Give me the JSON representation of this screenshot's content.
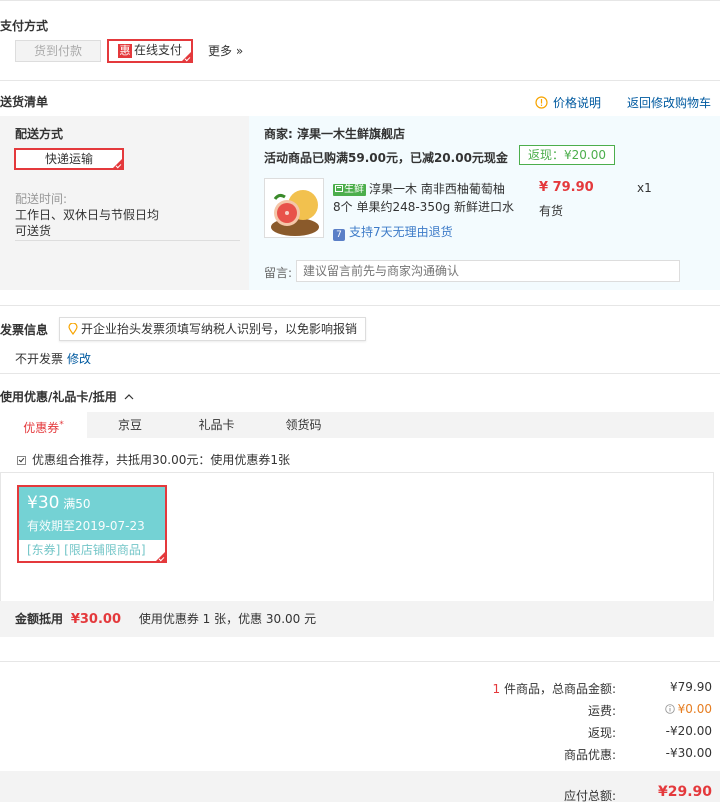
{
  "payment": {
    "title": "支付方式",
    "cod_label": "货到付款",
    "hui_badge": "惠",
    "online_label": "在线支付",
    "more_label": "更多 »"
  },
  "delivery": {
    "title": "送货清单",
    "price_info_link": "价格说明",
    "back_to_cart_link": "返回修改购物车",
    "method_title": "配送方式",
    "method_value": "快递运输",
    "time_label": "配送时间:",
    "time_value_line1": "工作日、双休日与节假日均",
    "time_value_line2": "可送货"
  },
  "shop": {
    "merchant_label": "商家:",
    "merchant_name": "淳果一木生鲜旗舰店",
    "promo_text": "活动商品已购满59.00元，已减20.00元现金",
    "fanxian_label": "返现：¥20.00"
  },
  "product": {
    "tag": "生鲜",
    "name_line1": "淳果一木 南非西柚葡萄柚",
    "name_line2": "8个 单果约248-350g 新鲜进口水",
    "price": "¥ 79.90",
    "quantity": "x1",
    "stock": "有货",
    "return_policy": "支持7天无理由退货"
  },
  "message": {
    "label": "留言:",
    "placeholder": "建议留言前先与商家沟通确认"
  },
  "invoice": {
    "title": "发票信息",
    "tip": "开企业抬头发票须填写纳税人识别号，以免影响报销",
    "value": "不开发票",
    "edit_link": "修改"
  },
  "coupons": {
    "title": "使用优惠/礼品卡/抵用",
    "tabs": [
      "优惠券",
      "京豆",
      "礼品卡",
      "领货码"
    ],
    "tab_mark": "*",
    "recommend_text": "优惠组合推荐，共抵用30.00元：使用优惠券1张",
    "coupon_amount": "¥30",
    "coupon_condition": "满50",
    "coupon_expiry": "有效期至2019-07-23",
    "coupon_scope": "[东券]  [限店铺限商品]",
    "summary_label": "金额抵用",
    "summary_amount": "¥30.00",
    "summary_detail": "使用优惠券 1 张，优惠 30.00 元"
  },
  "totals": {
    "item_count": "1",
    "items_label": "件商品，总商品金额:",
    "items_value": "¥79.90",
    "shipping_label": "运费:",
    "shipping_value": "¥0.00",
    "cashback_label": "返现:",
    "cashback_value": "-¥20.00",
    "discount_label": "商品优惠:",
    "discount_value": "-¥30.00",
    "payable_label": "应付总额:",
    "payable_value": "¥29.90"
  },
  "colors": {
    "accent_red": "#e4393c",
    "link_blue": "#005aa0",
    "coupon_teal": "#74d2d4",
    "success_green": "#4cae4c"
  }
}
